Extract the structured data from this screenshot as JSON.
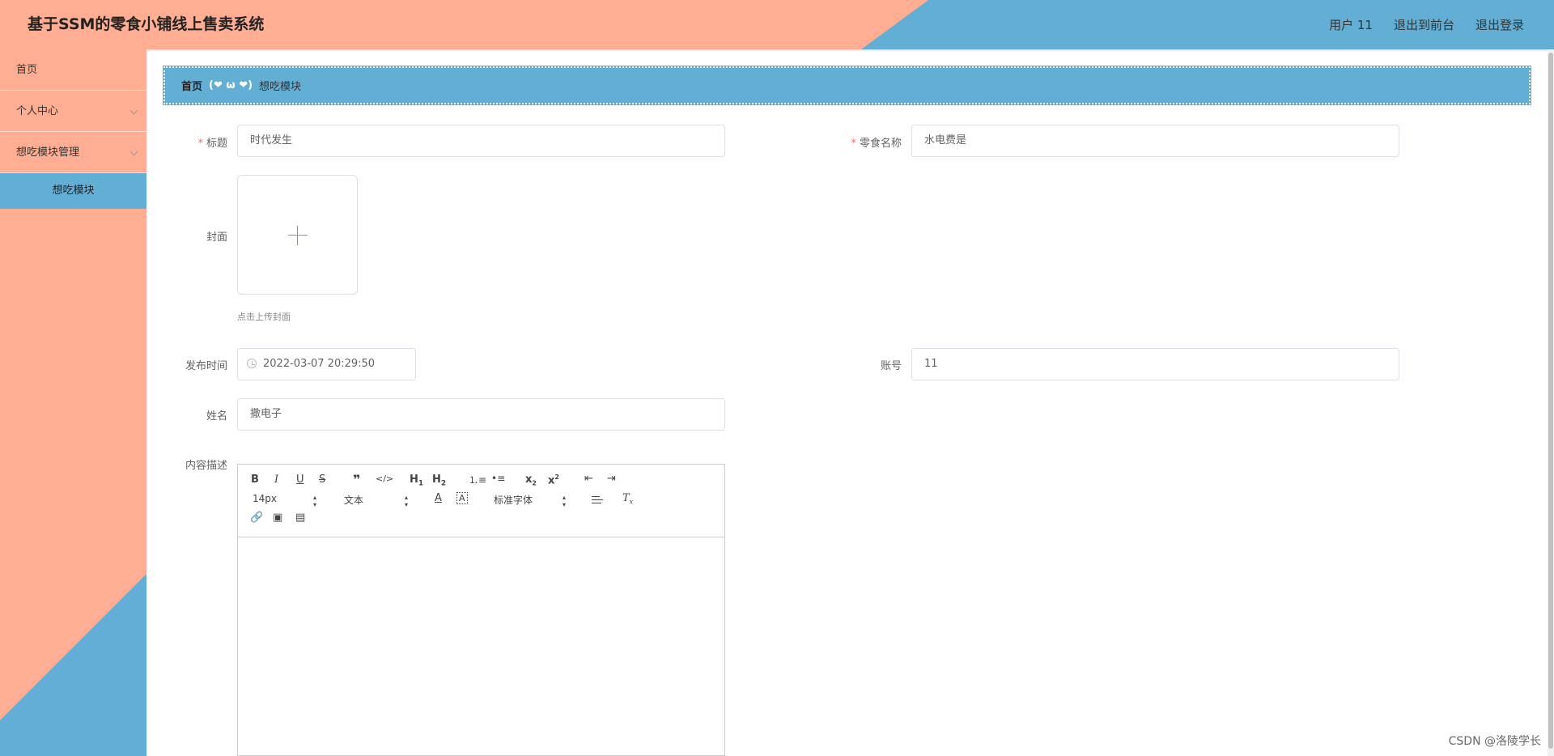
{
  "header": {
    "title": "基于SSM的零食小铺线上售卖系统",
    "user": "用户 11",
    "to_front": "退出到前台",
    "logout": "退出登录"
  },
  "sidebar": {
    "items": [
      {
        "label": "首页"
      },
      {
        "label": "个人中心"
      },
      {
        "label": "想吃模块管理"
      },
      {
        "label": "想吃模块"
      }
    ]
  },
  "breadcrumb": {
    "home": "首页",
    "separator": "(❤ ω ❤)",
    "current": "想吃模块"
  },
  "form": {
    "title_label": "标题",
    "title_value": "时代发生",
    "snack_label": "零食名称",
    "snack_value": "水电费是",
    "cover_label": "封面",
    "cover_tip": "点击上传封面",
    "time_label": "发布时间",
    "time_value": "2022-03-07 20:29:50",
    "account_label": "账号",
    "account_value": "11",
    "name_label": "姓名",
    "name_value": "撒电子",
    "desc_label": "内容描述"
  },
  "editor": {
    "font_size": "14px",
    "header_select": "文本",
    "font_family": "标准字体"
  },
  "watermark": "CSDN @洛陵学长",
  "colors": {
    "salmon": "#FFAE93",
    "blue": "#62AED5",
    "required": "#F56C6C"
  }
}
